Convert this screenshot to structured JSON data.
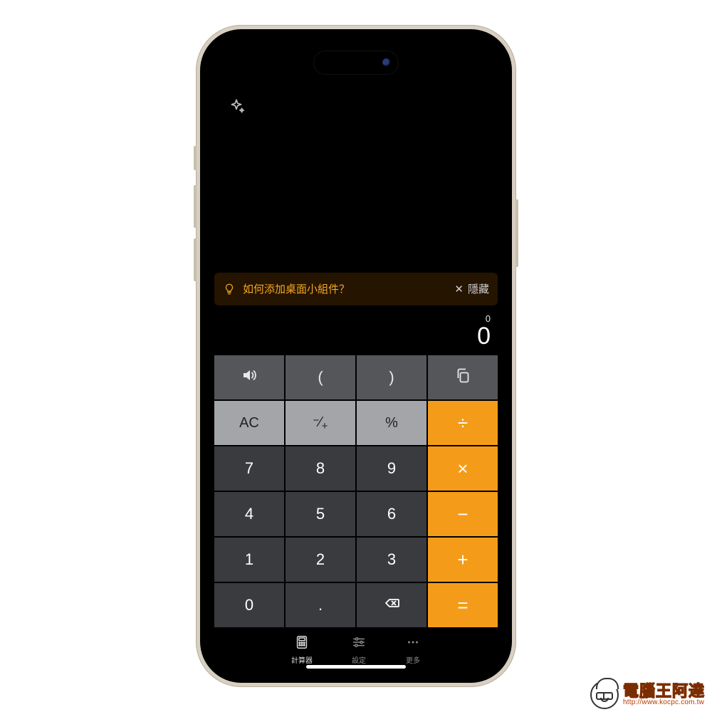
{
  "tip": {
    "text": "如何添加桌面小組件？",
    "close_label": "隱藏"
  },
  "display": {
    "small": "0",
    "big": "0"
  },
  "keys": {
    "sound": "sound",
    "lparen": "(",
    "rparen": ")",
    "copy": "copy",
    "ac": "AC",
    "negate": "⁻⁄₊",
    "percent": "%",
    "divide": "÷",
    "k7": "7",
    "k8": "8",
    "k9": "9",
    "multiply": "×",
    "k4": "4",
    "k5": "5",
    "k6": "6",
    "minus": "−",
    "k1": "1",
    "k2": "2",
    "k3": "3",
    "plus": "+",
    "k0": "0",
    "dot": ".",
    "del": "del",
    "equals": "="
  },
  "tabs": {
    "calculator": "計算器",
    "settings": "設定",
    "more": "更多"
  },
  "watermark": {
    "title": "電腦王阿達",
    "url": "http://www.kocpc.com.tw"
  }
}
